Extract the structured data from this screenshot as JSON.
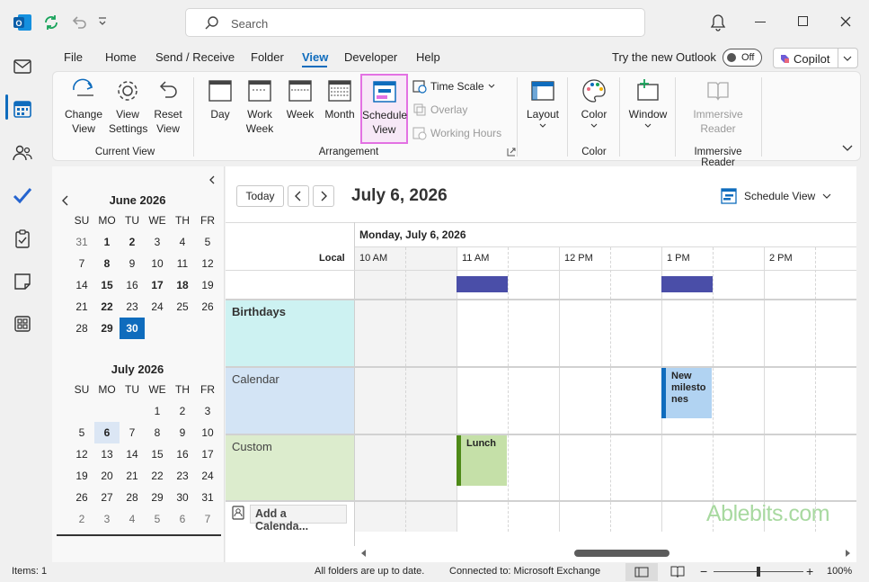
{
  "titlebar": {
    "search_placeholder": "Search"
  },
  "menu": {
    "items": [
      "File",
      "Home",
      "Send / Receive",
      "Folder",
      "View",
      "Developer",
      "Help"
    ],
    "try_new": "Try the new Outlook",
    "toggle": "Off",
    "copilot": "Copilot"
  },
  "ribbon": {
    "change_view": "Change View",
    "view_settings": "View Settings",
    "reset_view": "Reset View",
    "group_current": "Current View",
    "day": "Day",
    "work_week": "Work Week",
    "week": "Week",
    "month": "Month",
    "schedule_view": "Schedule View",
    "time_scale": "Time Scale",
    "overlay": "Overlay",
    "working_hours": "Working Hours",
    "group_arrangement": "Arrangement",
    "layout": "Layout",
    "color": "Color",
    "group_color": "Color",
    "window": "Window",
    "immersive_reader": "Immersive Reader",
    "group_immersive": "Immersive Reader"
  },
  "june": {
    "title": "June 2026",
    "days": [
      "SU",
      "MO",
      "TU",
      "WE",
      "TH",
      "FR"
    ],
    "cells": [
      "31",
      "1",
      "2",
      "3",
      "4",
      "5",
      "7",
      "8",
      "9",
      "10",
      "11",
      "12",
      "14",
      "15",
      "16",
      "17",
      "18",
      "19",
      "21",
      "22",
      "23",
      "24",
      "25",
      "26",
      "28",
      "29",
      "30",
      "",
      "",
      ""
    ]
  },
  "july": {
    "title": "July 2026",
    "days": [
      "SU",
      "MO",
      "TU",
      "WE",
      "TH",
      "FR"
    ],
    "cells": [
      "",
      "",
      "",
      "1",
      "2",
      "3",
      "5",
      "6",
      "7",
      "8",
      "9",
      "10",
      "12",
      "13",
      "14",
      "15",
      "16",
      "17",
      "19",
      "20",
      "21",
      "22",
      "23",
      "24",
      "26",
      "27",
      "28",
      "29",
      "30",
      "31",
      "2",
      "3",
      "4",
      "5",
      "6",
      "7"
    ]
  },
  "main": {
    "today_btn": "Today",
    "date_title": "July 6, 2026",
    "view_select": "Schedule View",
    "day_header": "Monday, July 6, 2026",
    "local": "Local",
    "times": [
      "10 AM",
      "11 AM",
      "12 PM",
      "1 PM",
      "2 PM"
    ],
    "rows": [
      "Birthdays",
      "Calendar",
      "Custom"
    ],
    "add_calendar": "Add a Calenda...",
    "events": {
      "milestones": "New milesto nes",
      "lunch": "Lunch"
    },
    "watermark": "Ablebits.com"
  },
  "status": {
    "items": "Items: 1",
    "sync": "All folders are up to date.",
    "connected": "Connected to: Microsoft Exchange",
    "zoom": "100%"
  },
  "colors": {
    "accent": "#0f6cbd",
    "birthdays": "#cdf2f2",
    "calendar": "#d3e4f5",
    "custom": "#dceccd",
    "freebusy": "#4a4ea8",
    "lunch": "#c5e0a8",
    "milestone": "#b1d3f2"
  }
}
